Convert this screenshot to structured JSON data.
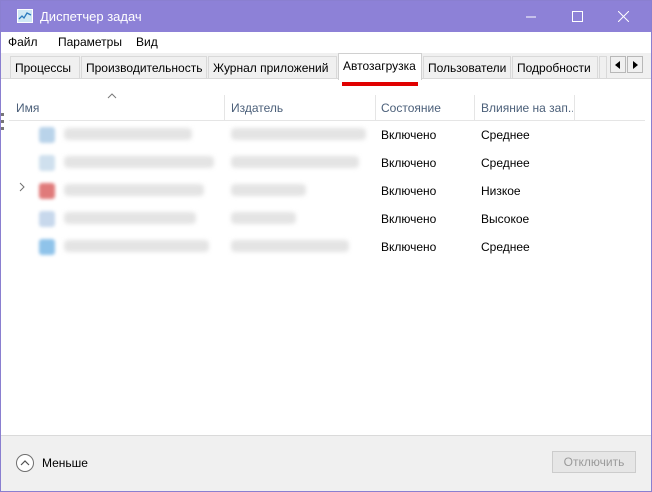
{
  "window": {
    "title": "Диспетчер задач"
  },
  "menu": {
    "file": "Файл",
    "params": "Параметры",
    "view": "Вид"
  },
  "tabs": [
    {
      "label": "Процессы"
    },
    {
      "label": "Производительность"
    },
    {
      "label": "Журнал приложений"
    },
    {
      "label": "Автозагрузка"
    },
    {
      "label": "Пользователи"
    },
    {
      "label": "Подробности"
    }
  ],
  "active_tab": "Автозагрузка",
  "columns": {
    "name": "Имя",
    "publisher": "Издатель",
    "status": "Состояние",
    "impact": "Влияние на зап..."
  },
  "rows": [
    {
      "status": "Включено",
      "impact": "Среднее",
      "icon_color": "#b9d3ea"
    },
    {
      "status": "Включено",
      "impact": "Среднее",
      "icon_color": "#cfe0ee"
    },
    {
      "status": "Включено",
      "impact": "Низкое",
      "icon_color": "#e07a7a"
    },
    {
      "status": "Включено",
      "impact": "Высокое",
      "icon_color": "#c7d8ec"
    },
    {
      "status": "Включено",
      "impact": "Среднее",
      "icon_color": "#8fc3ea"
    }
  ],
  "footer": {
    "less_label": "Меньше",
    "disable_label": "Отключить"
  },
  "colors": {
    "titlebar": "#8d81d7",
    "accent_underline": "#e00000",
    "header_text": "#4c607a"
  }
}
